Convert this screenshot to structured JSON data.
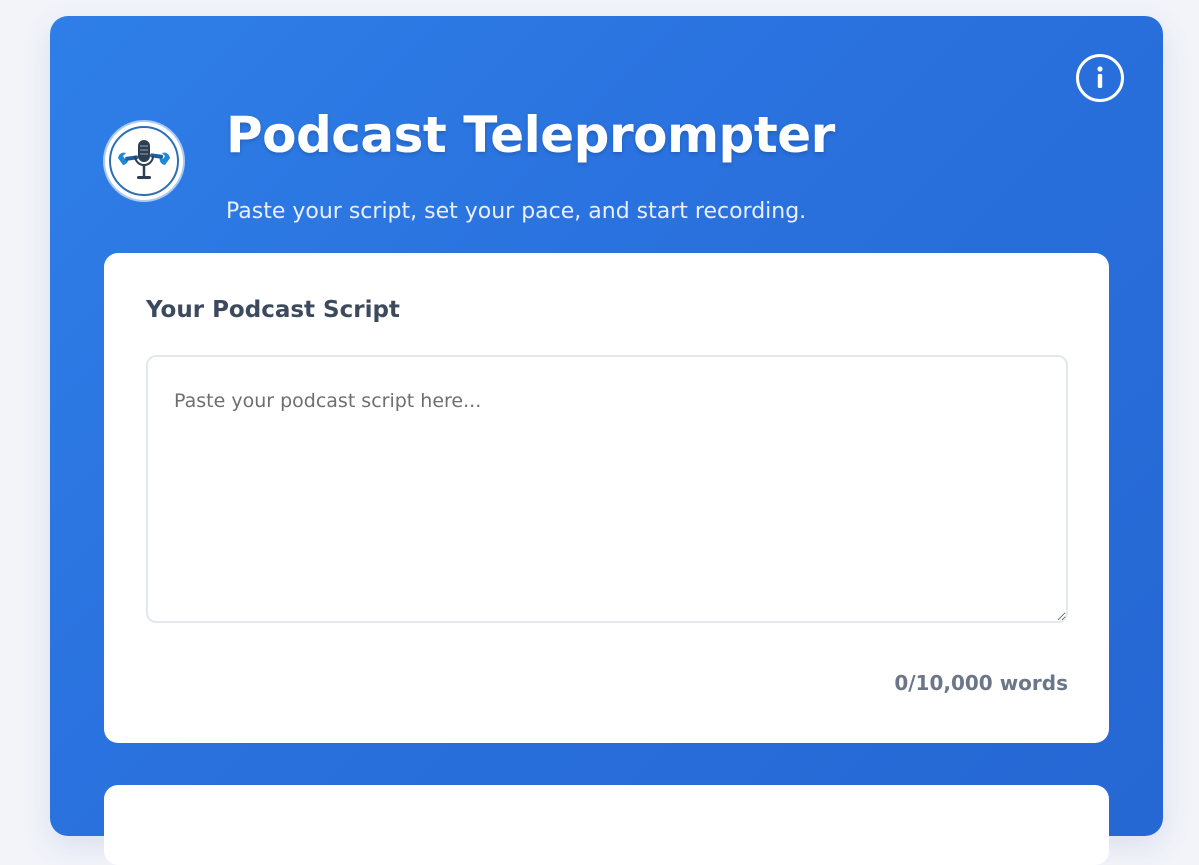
{
  "header": {
    "title": "Podcast Teleprompter",
    "subtitle": "Paste your script, set your pace, and start recording.",
    "logo_icon": "microphone-wrench-logo",
    "info_icon": "info-icon"
  },
  "script": {
    "label": "Your Podcast Script",
    "placeholder": "Paste your podcast script here...",
    "value": "",
    "word_count": "0/10,000 words"
  },
  "colors": {
    "background_gradient_start": "#2f7fe8",
    "background_gradient_end": "#2567d3",
    "panel": "#ffffff",
    "label": "#3d4a5e",
    "muted": "#6b7689"
  }
}
